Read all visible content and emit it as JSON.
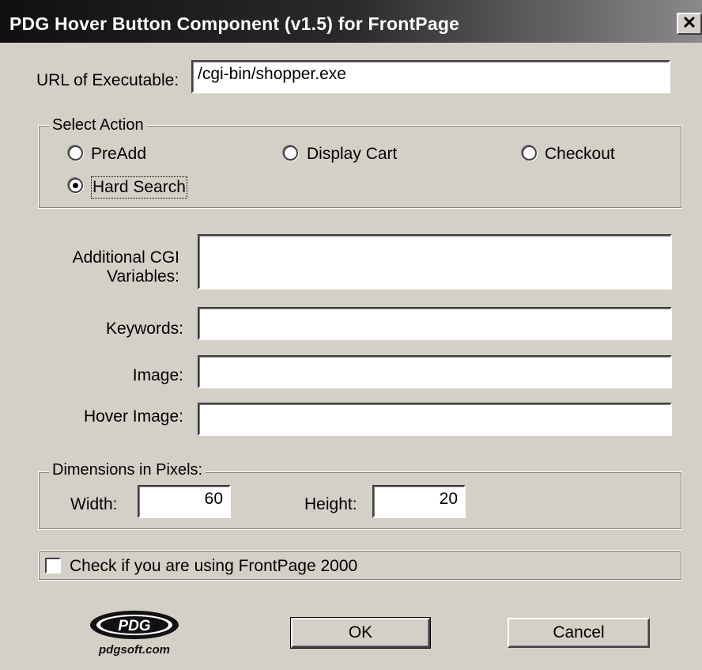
{
  "window": {
    "title": "PDG Hover Button Component (v1.5) for FrontPage",
    "close_glyph": "✕"
  },
  "url": {
    "label": "URL of Executable:",
    "value": "/cgi-bin/shopper.exe"
  },
  "action": {
    "title": "Select Action",
    "options": [
      {
        "label": "PreAdd",
        "checked": false
      },
      {
        "label": "Display Cart",
        "checked": false
      },
      {
        "label": "Checkout",
        "checked": false
      },
      {
        "label": "Hard Search",
        "checked": true
      }
    ]
  },
  "cgi": {
    "label_line1": "Additional CGI",
    "label_line2": "Variables:",
    "value": ""
  },
  "keywords": {
    "label": "Keywords:",
    "value": ""
  },
  "image": {
    "label": "Image:",
    "value": ""
  },
  "hover_image": {
    "label": "Hover Image:",
    "value": ""
  },
  "dimensions": {
    "title": "Dimensions in Pixels:",
    "width_label": "Width:",
    "width_value": "60",
    "height_label": "Height:",
    "height_value": "20"
  },
  "frontpage2000": {
    "label": "Check if you are using FrontPage 2000",
    "checked": false
  },
  "logo": {
    "mark": "PDG",
    "site": "pdgsoft.com"
  },
  "buttons": {
    "ok": "OK",
    "cancel": "Cancel"
  },
  "icons": {
    "close": "close-icon",
    "radio": "radio-icon",
    "checkbox": "checkbox-icon"
  }
}
